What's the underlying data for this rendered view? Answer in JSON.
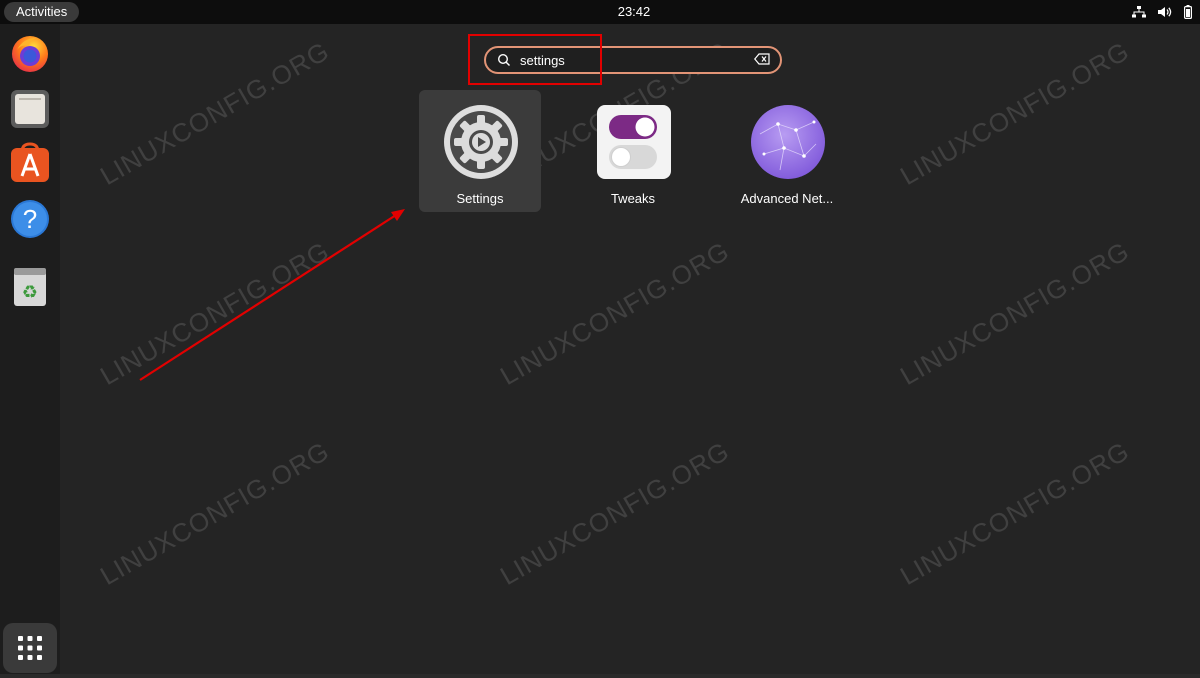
{
  "topbar": {
    "activities_label": "Activities",
    "clock": "23:42",
    "tray_icons": [
      "network-icon",
      "volume-icon",
      "battery-icon"
    ]
  },
  "dock": {
    "items": [
      {
        "name": "firefox",
        "icon": "firefox-icon"
      },
      {
        "name": "files",
        "icon": "files-icon"
      },
      {
        "name": "app-center",
        "icon": "app-store-icon"
      },
      {
        "name": "help",
        "icon": "help-icon"
      },
      {
        "name": "trash",
        "icon": "trash-icon"
      }
    ],
    "show_apps_icon": "grid-icon"
  },
  "search": {
    "value": "settings",
    "placeholder": ""
  },
  "results": [
    {
      "label": "Settings",
      "icon": "gear-icon",
      "selected": true
    },
    {
      "label": "Tweaks",
      "icon": "toggle-icon",
      "selected": false
    },
    {
      "label": "Advanced Net...",
      "icon": "network-globe-icon",
      "selected": false
    }
  ],
  "watermark": "LINUXCONFIG.ORG",
  "colors": {
    "background": "#242424",
    "topbar": "#0d0d0d",
    "search_border": "#e29476",
    "annotation_red": "#e20000",
    "tweaks_purple": "#7c2a85"
  }
}
